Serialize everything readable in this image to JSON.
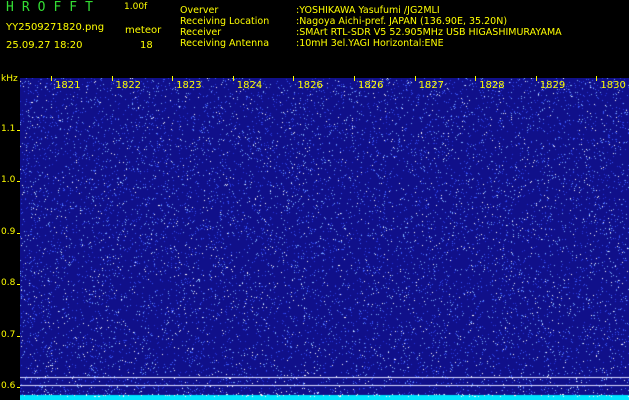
{
  "header": {
    "app_title": "HROFFT",
    "version": "1.00f",
    "filename": "YY2509271820.png",
    "timestamp": "25.09.27 18:20",
    "meteor_label": "meteor",
    "meteor_count": "18",
    "info": [
      {
        "key": "Overver",
        "value": ":YOSHIKAWA Yasufumi /JG2MLI"
      },
      {
        "key": "Receiving Location",
        "value": ":Nagoya Aichi-pref. JAPAN (136.90E, 35.20N)"
      },
      {
        "key": "Receiver",
        "value": ":SMArt RTL-SDR V5 52.905MHz USB HIGASHIMURAYAMA"
      },
      {
        "key": "Receiving Antenna",
        "value": ":10mH 3el.YAGI Horizontal:ENE"
      }
    ]
  },
  "colors": {
    "background": "#000000",
    "text": "#ffff00",
    "title": "#33dd33",
    "spectrogram_base": "#10108a",
    "signal_band": "#00e5ff"
  },
  "chart_data": {
    "type": "heatmap",
    "xlabel": "",
    "ylabel": "kHz",
    "x_tick_labels": [
      "1821",
      "1822",
      "1823",
      "1824",
      "1826",
      "1826",
      "1827",
      "1828",
      "1829",
      "1830"
    ],
    "y_tick_labels": [
      "1.1",
      "1.0",
      "0.9",
      "0.8",
      "0.7",
      "0.6"
    ],
    "y_ticks": [
      1.1,
      1.0,
      0.9,
      0.8,
      0.7,
      0.6
    ],
    "ylim": [
      0.575,
      1.2
    ],
    "horizontal_lines_khz": [
      0.62,
      0.605
    ],
    "bright_band_khz": [
      0.575,
      0.585
    ],
    "noise_colors": [
      "#ffffff",
      "#7fb0ff",
      "#3c5cff",
      "#2a3ae0"
    ]
  }
}
